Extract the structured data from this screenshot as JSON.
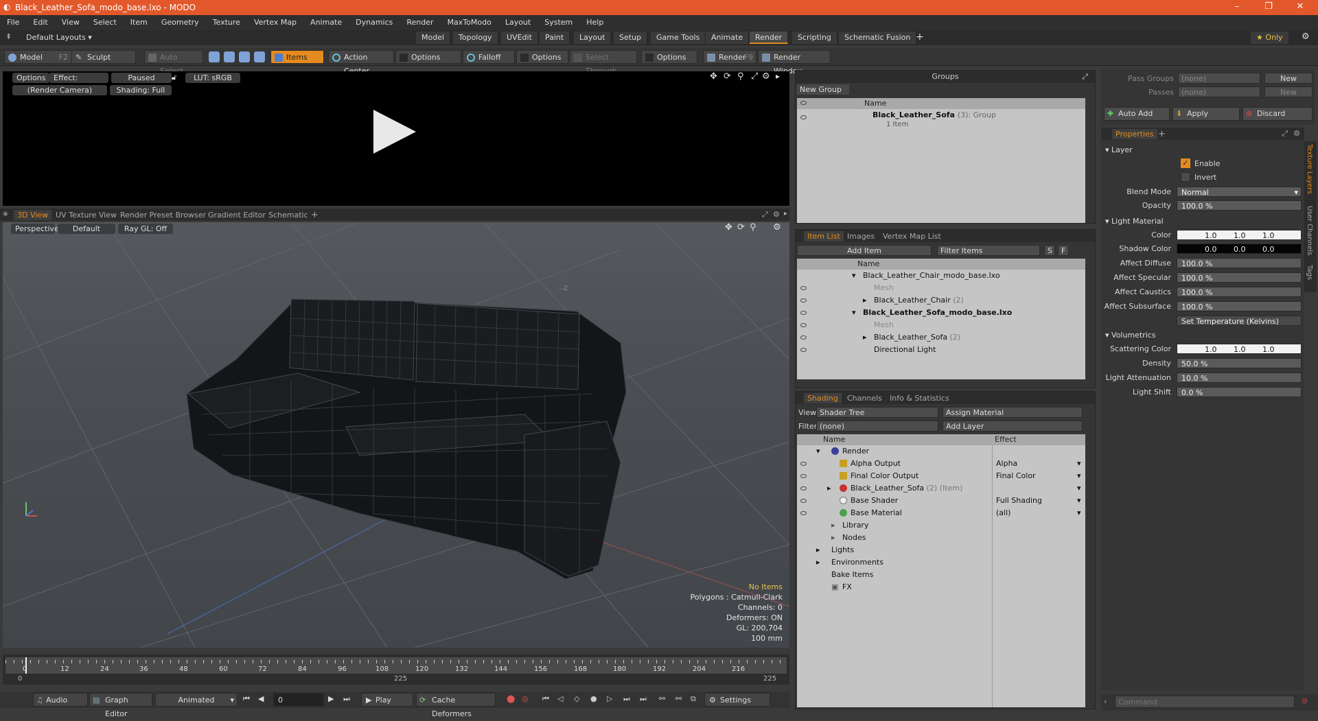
{
  "app": {
    "title": "Black_Leather_Sofa_modo_base.lxo - MODO",
    "win_min": "–",
    "win_max": "❐",
    "win_close": "✕"
  },
  "menu": [
    "File",
    "Edit",
    "View",
    "Select",
    "Item",
    "Geometry",
    "Texture",
    "Vertex Map",
    "Animate",
    "Dynamics",
    "Render",
    "MaxToModo",
    "Layout",
    "System",
    "Help"
  ],
  "layoutbar": {
    "default_layouts": "Default Layouts ▾",
    "tabs": [
      "Model",
      "Topology",
      "UVEdit",
      "Paint",
      "Layout",
      "Setup",
      "Game Tools",
      "Animate",
      "Render",
      "Scripting",
      "Schematic Fusion"
    ],
    "active_tab": "Render",
    "add": "+",
    "only": "★  Only"
  },
  "toolbar": {
    "model": "Model",
    "model_key": "F2",
    "sculpt": "Sculpt",
    "auto_select": "Auto Select",
    "items": "Items",
    "action_center": "Action Center",
    "options1": "Options",
    "falloff": "Falloff",
    "options2": "Options",
    "select_through": "Select Through",
    "options3": "Options",
    "render": "Render",
    "render_key": "F9",
    "render_window": "Render Window"
  },
  "render_view": {
    "options": "Options",
    "effect": "Effect: (Shadi...",
    "paused": "Paused",
    "lut": "LUT: sRGB",
    "camera": "(Render Camera)",
    "shading": "Shading: Full"
  },
  "viewport_tabs": {
    "tabs": [
      "3D View",
      "UV Texture View",
      "Render Preset Browser",
      "Gradient Editor",
      "Schematic"
    ],
    "active": "3D View",
    "add": "+"
  },
  "viewport": {
    "perspective": "Perspective",
    "default": "Default",
    "raygl": "Ray GL: Off",
    "hud": [
      "No Items",
      "Polygons : Catmull-Clark",
      "Channels: 0",
      "Deformers: ON",
      "GL: 200,704",
      "100 mm"
    ],
    "axis_z": "-Z"
  },
  "timeline": {
    "ticks": [
      "0",
      "12",
      "24",
      "36",
      "48",
      "60",
      "72",
      "84",
      "96",
      "108",
      "120",
      "132",
      "144",
      "156",
      "168",
      "180",
      "192",
      "204",
      "216"
    ],
    "start": "0",
    "mid": "225",
    "end": "225"
  },
  "transport": {
    "audio": "Audio",
    "graph_editor": "Graph Editor",
    "animated": "Animated",
    "frame": "0",
    "play": "Play",
    "cache_deformers": "Cache Deformers",
    "settings": "Settings"
  },
  "groups": {
    "title": "Groups",
    "new_group": "New Group",
    "col_name": "Name",
    "row_name": "Black_Leather_Sofa",
    "row_count": "(3)",
    "row_type": ": Group",
    "row_sub": "1 Item"
  },
  "itemlist": {
    "tabs": [
      "Item List",
      "Images",
      "Vertex Map List"
    ],
    "add_item": "Add Item",
    "filter_items": "Filter Items",
    "s": "S",
    "f": "F",
    "col_name": "Name",
    "rows": [
      {
        "name": "Black_Leather_Chair_modo_base.lxo",
        "extra": ""
      },
      {
        "name": "Mesh",
        "extra": ""
      },
      {
        "name": "Black_Leather_Chair",
        "extra": "(2)"
      },
      {
        "name": "Black_Leather_Sofa_modo_base.lxo",
        "extra": ""
      },
      {
        "name": "Mesh",
        "extra": ""
      },
      {
        "name": "Black_Leather_Sofa",
        "extra": "(2)"
      },
      {
        "name": "Directional Light",
        "extra": ""
      }
    ]
  },
  "shading": {
    "tabs": [
      "Shading",
      "Channels",
      "Info & Statistics"
    ],
    "view_label": "View",
    "view_value": "Shader Tree",
    "assign_material": "Assign Material",
    "filter_label": "Filter",
    "filter_value": "(none)",
    "add_layer": "Add Layer",
    "col_name": "Name",
    "col_effect": "Effect",
    "rows": [
      {
        "name": "Render",
        "extra": "",
        "effect": ""
      },
      {
        "name": "Alpha Output",
        "extra": "",
        "effect": "Alpha"
      },
      {
        "name": "Final Color Output",
        "extra": "",
        "effect": "Final Color"
      },
      {
        "name": "Black_Leather_Sofa",
        "extra": "(2) (Item)",
        "effect": ""
      },
      {
        "name": "Base Shader",
        "extra": "",
        "effect": "Full Shading"
      },
      {
        "name": "Base Material",
        "extra": "",
        "effect": "(all)"
      },
      {
        "name": "Library",
        "extra": "",
        "effect": ""
      },
      {
        "name": "Nodes",
        "extra": "",
        "effect": ""
      },
      {
        "name": "Lights",
        "extra": "",
        "effect": ""
      },
      {
        "name": "Environments",
        "extra": "",
        "effect": ""
      },
      {
        "name": "Bake Items",
        "extra": "",
        "effect": ""
      },
      {
        "name": "FX",
        "extra": "",
        "effect": ""
      }
    ]
  },
  "passes": {
    "pass_groups_label": "Pass Groups",
    "pass_groups_value": "(none)",
    "passes_label": "Passes",
    "passes_value": "(none)",
    "new": "New",
    "auto_add": "Auto Add",
    "apply": "Apply",
    "discard": "Discard"
  },
  "properties": {
    "tab": "Properties",
    "add": "+",
    "side_tabs": [
      "Texture Layers",
      "User Channels",
      "Tags"
    ],
    "layer_section": "Layer",
    "enable": "Enable",
    "invert": "Invert",
    "blend_mode_label": "Blend Mode",
    "blend_mode": "Normal",
    "opacity_label": "Opacity",
    "opacity": "100.0 %",
    "light_material": "Light Material",
    "color_label": "Color",
    "color": [
      "1.0",
      "1.0",
      "1.0"
    ],
    "shadow_label": "Shadow Color",
    "shadow": [
      "0.0",
      "0.0",
      "0.0"
    ],
    "affect_diffuse_label": "Affect Diffuse",
    "affect_diffuse": "100.0 %",
    "affect_specular_label": "Affect Specular",
    "affect_specular": "100.0 %",
    "affect_caustics_label": "Affect Caustics",
    "affect_caustics": "100.0 %",
    "affect_subsurface_label": "Affect Subsurface",
    "affect_subsurface": "100.0 %",
    "set_temp": "Set Temperature (Kelvins)",
    "volumetrics": "Volumetrics",
    "scattering_label": "Scattering Color",
    "scattering": [
      "1.0",
      "1.0",
      "1.0"
    ],
    "density_label": "Density",
    "density": "50.0 %",
    "attenuation_label": "Light Attenuation",
    "attenuation": "10.0 %",
    "shift_label": "Light Shift",
    "shift": "0.0 %"
  },
  "command": {
    "placeholder": "Command"
  },
  "colors": {
    "accent": "#e58a1e",
    "titlebar": "#e2582b"
  }
}
